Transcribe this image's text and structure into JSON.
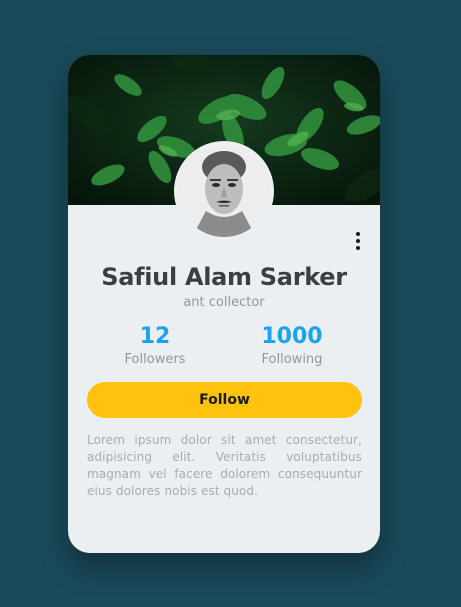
{
  "profile": {
    "name": "Safiul Alam Sarker",
    "title": "ant collector",
    "followers_count": "12",
    "followers_label": "Followers",
    "following_count": "1000",
    "following_label": "Following",
    "follow_button": "Follow",
    "bio": "Lorem ipsum dolor sit amet consectetur, adipisicing elit. Veritatis voluptatibus magnam vel facere dolorem consequuntur eius dolores nobis est quod."
  },
  "icons": {
    "menu": "more-vertical-icon"
  },
  "colors": {
    "page_background": "#1a4a5a",
    "card_background": "#eceff1",
    "accent_blue": "#1aa3f0",
    "button_yellow": "#ffc20e",
    "name_text": "#3a3f45",
    "muted_text": "#8b98a4"
  }
}
